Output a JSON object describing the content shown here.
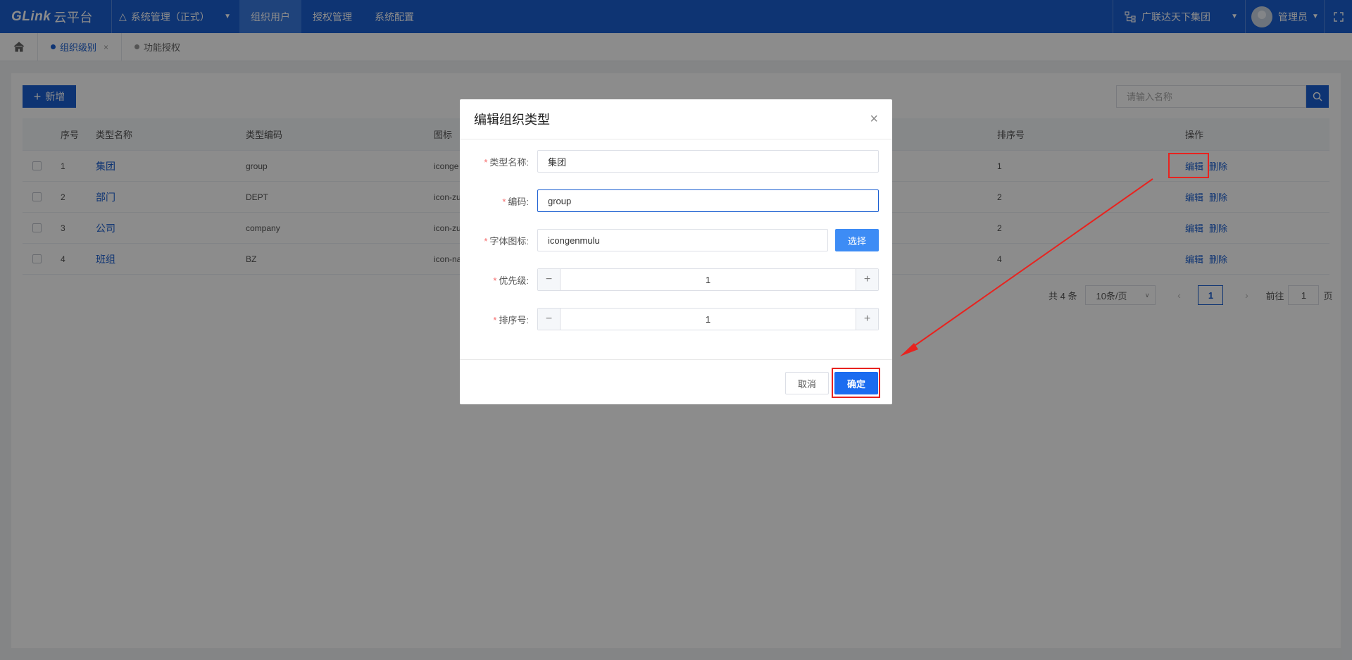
{
  "header": {
    "logo_text": "GLink",
    "logo_cn": "云平台",
    "system_select": "系统管理（正式）",
    "nav": [
      {
        "label": "组织用户"
      },
      {
        "label": "授权管理"
      },
      {
        "label": "系统配置"
      }
    ],
    "org_select": "广联达天下集团",
    "user_name": "管理员"
  },
  "tabs": [
    {
      "label": "组织级别",
      "close": "×"
    },
    {
      "label": "功能授权"
    }
  ],
  "toolbar": {
    "add_label": "新增",
    "search_placeholder": "请输入名称"
  },
  "table": {
    "headers": {
      "no": "序号",
      "name": "类型名称",
      "code": "类型编码",
      "icon": "图标",
      "sort": "排序号",
      "ops": "操作"
    },
    "rows": [
      {
        "no": "1",
        "name": "集团",
        "code": "group",
        "icon": "iconge",
        "sort": "1",
        "edit": "编辑",
        "delete": "删除"
      },
      {
        "no": "2",
        "name": "部门",
        "code": "DEPT",
        "icon": "icon-zu",
        "sort": "2",
        "edit": "编辑",
        "delete": "删除"
      },
      {
        "no": "3",
        "name": "公司",
        "code": "company",
        "icon": "icon-zu",
        "sort": "2",
        "edit": "编辑",
        "delete": "删除"
      },
      {
        "no": "4",
        "name": "班组",
        "code": "BZ",
        "icon": "icon-na",
        "sort": "4",
        "edit": "编辑",
        "delete": "删除"
      }
    ]
  },
  "pagination": {
    "total": "共 4 条",
    "page_size": "10条/页",
    "current": "1",
    "goto_prefix": "前往",
    "goto_value": "1",
    "goto_suffix": "页"
  },
  "modal": {
    "title": "编辑组织类型",
    "fields": {
      "name_label": "类型名称:",
      "name_value": "集团",
      "code_label": "编码:",
      "code_value": "group",
      "icon_label": "字体图标:",
      "icon_value": "icongenmulu",
      "choose_label": "选择",
      "priority_label": "优先级:",
      "priority_value": "1",
      "sort_label": "排序号:",
      "sort_value": "1"
    },
    "cancel_label": "取消",
    "ok_label": "确定"
  },
  "colors": {
    "primary": "#1b5fd1",
    "annotation": "#e8231f"
  }
}
